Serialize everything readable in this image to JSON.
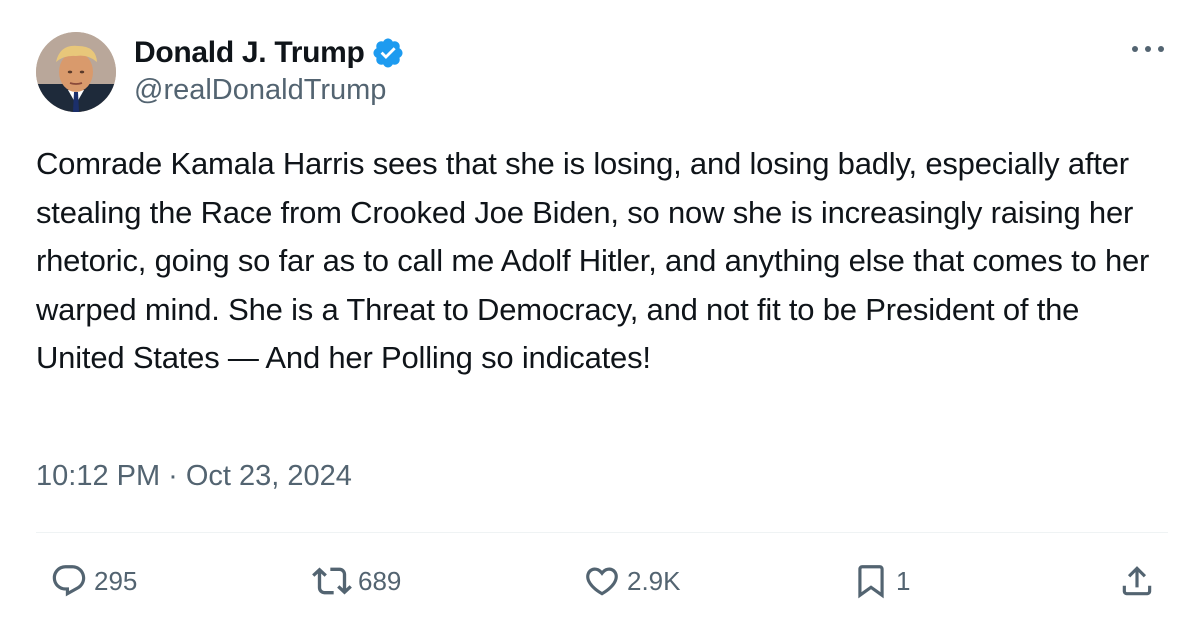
{
  "author": {
    "display_name": "Donald J. Trump",
    "handle": "@realDonaldTrump",
    "verified": true,
    "verified_color": "#1d9bf0"
  },
  "tweet": {
    "text": "Comrade Kamala Harris sees that she is losing, and losing badly, especially after stealing the Race from Crooked Joe Biden, so now she is increasingly raising her rhetoric, going so far as to call me Adolf Hitler, and anything else that comes to her warped mind. She is a Threat to Democracy, and not fit to be President of the United States — And her Polling so indicates!",
    "time": "10:12 PM",
    "separator": "·",
    "date": "Oct 23, 2024"
  },
  "actions": {
    "reply": {
      "icon": "reply-icon",
      "count": "295"
    },
    "retweet": {
      "icon": "retweet-icon",
      "count": "689"
    },
    "like": {
      "icon": "heart-icon",
      "count": "2.9K"
    },
    "bookmark": {
      "icon": "bookmark-icon",
      "count": "1"
    },
    "share": {
      "icon": "share-icon"
    }
  },
  "colors": {
    "text_primary": "#0f1419",
    "text_secondary": "#536471",
    "divider": "#eff3f4"
  }
}
